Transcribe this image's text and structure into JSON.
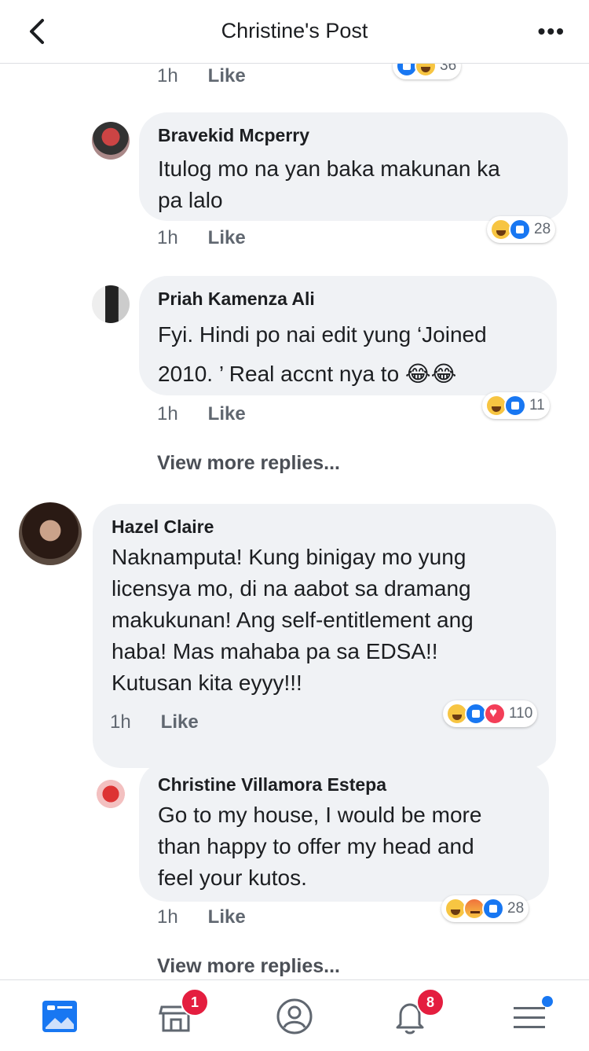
{
  "header": {
    "title": "Christine's Post"
  },
  "first_meta": {
    "time": "1h",
    "like": "Like",
    "count": "36"
  },
  "comments": [
    {
      "name": "Bravekid Mcperry",
      "lines": [
        "Itulog mo na yan baka makunan ka",
        "pa lalo"
      ],
      "time": "1h",
      "like": "Like",
      "reaction_count": "28",
      "reactions": [
        "haha-icon",
        "like-icon"
      ]
    },
    {
      "name": "Priah Kamenza Ali",
      "lines": [
        "Fyi. Hindi po nai edit yung ‘Joined",
        "2010. ’ Real accnt nya to 😂😂"
      ],
      "time": "1h",
      "like": "Like",
      "reaction_count": "11",
      "reactions": [
        "haha-icon",
        "like-icon"
      ]
    },
    {
      "name": "Hazel Claire",
      "lines": [
        "Naknamputa! Kung binigay mo yung",
        "licensya mo, di na aabot sa dramang",
        "makukunan! Ang self-entitlement ang",
        "haba! Mas mahaba pa sa EDSA!!",
        "Kutusan kita eyyy!!!"
      ],
      "time": "1h",
      "like": "Like",
      "reaction_count": "110",
      "reactions": [
        "haha-icon",
        "like-icon",
        "love-icon"
      ]
    },
    {
      "name": "Christine Villamora Estepa",
      "lines": [
        "Go to my house, I would be more",
        "than happy to offer my head and",
        "feel your kutos."
      ],
      "time": "1h",
      "like": "Like",
      "reaction_count": "28",
      "reactions": [
        "haha-icon",
        "angry-icon",
        "like-icon"
      ]
    }
  ],
  "view_more": "View more replies...",
  "tabbar": {
    "marketplace_badge": "1",
    "notifications_badge": "8"
  },
  "colors": {
    "accent": "#1877f2",
    "badge": "#e41e3f",
    "bubble": "#f0f2f5"
  }
}
